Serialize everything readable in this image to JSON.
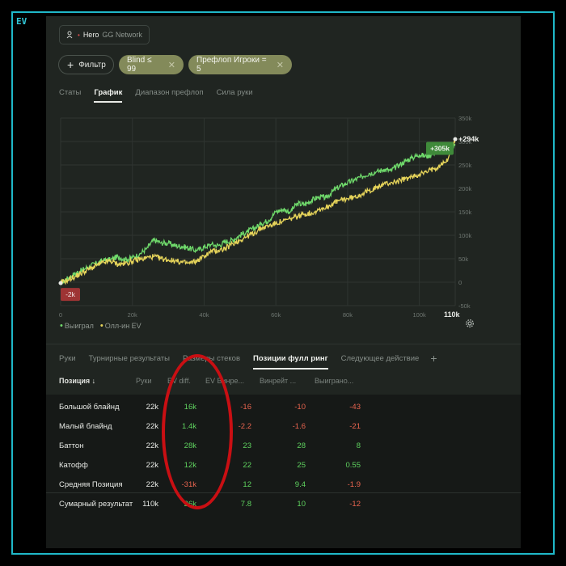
{
  "corner_tag": "EV",
  "player": {
    "name": "Hero",
    "network": "GG Network"
  },
  "filters": {
    "add_label": "Фильтр",
    "active": [
      {
        "label": "Blind ≤ 99"
      },
      {
        "label": "Префлоп Игроки = 5"
      }
    ]
  },
  "tabs": [
    "Статы",
    "График",
    "Диапазон префлоп",
    "Сила руки"
  ],
  "active_tab": "График",
  "chart_data": {
    "type": "line",
    "x": [
      0,
      2,
      4,
      6,
      8,
      10,
      12,
      14,
      16,
      18,
      20,
      22,
      24,
      26,
      28,
      30,
      32,
      34,
      36,
      38,
      40,
      42,
      44,
      46,
      48,
      50,
      52,
      54,
      56,
      58,
      60,
      62,
      64,
      66,
      68,
      70,
      72,
      74,
      76,
      78,
      80,
      82,
      84,
      86,
      88,
      90,
      92,
      94,
      96,
      98,
      100,
      102,
      104,
      106,
      108,
      110
    ],
    "series": [
      {
        "name": "Выиграл",
        "color": "#6fd96b",
        "values": [
          -2,
          8,
          18,
          26,
          34,
          40,
          46,
          48,
          55,
          48,
          52,
          60,
          72,
          90,
          84,
          83,
          78,
          76,
          72,
          67,
          75,
          80,
          78,
          86,
          90,
          100,
          108,
          115,
          125,
          132,
          150,
          155,
          150,
          168,
          165,
          175,
          182,
          180,
          195,
          205,
          212,
          218,
          225,
          232,
          235,
          240,
          238,
          248,
          258,
          265,
          272,
          268,
          275,
          285,
          280,
          294
        ]
      },
      {
        "name": "Олл-ин EV",
        "color": "#e6d45a",
        "values": [
          -2,
          5,
          12,
          20,
          28,
          35,
          42,
          45,
          38,
          40,
          45,
          48,
          52,
          55,
          50,
          48,
          45,
          42,
          40,
          46,
          55,
          65,
          68,
          72,
          82,
          90,
          98,
          105,
          115,
          120,
          126,
          130,
          135,
          140,
          145,
          148,
          155,
          160,
          168,
          175,
          178,
          182,
          188,
          195,
          202,
          208,
          212,
          215,
          220,
          225,
          230,
          235,
          242,
          250,
          262,
          305
        ]
      }
    ],
    "x_ticks": [
      "0",
      "20k",
      "40k",
      "60k",
      "80k",
      "100k"
    ],
    "x_end_label": "110k",
    "y_ticks": [
      "-50k",
      "0",
      "50k",
      "100k",
      "150k",
      "200k",
      "250k",
      "300k",
      "350k"
    ],
    "ylim": [
      -50,
      350
    ],
    "xlim": [
      0,
      110
    ],
    "start_label": "-2k",
    "end_labels": {
      "won": "+294k",
      "ev": "+305k"
    },
    "grid": true
  },
  "legend": [
    "Выиграл",
    "Олл-ин EV"
  ],
  "bottom_tabs": [
    "Руки",
    "Турнирные результаты",
    "Размеры стеков",
    "Позиции фулл ринг",
    "Следующее действие"
  ],
  "bottom_active": "Позиции фулл ринг",
  "table": {
    "headers": [
      "Позиция ↓",
      "Руки",
      "EV diff.",
      "EV Винре...",
      "Винрейт ...",
      "Выиграно..."
    ],
    "rows": [
      {
        "pos": "Большой блайнд",
        "hands": "22k",
        "evdiff": "16k",
        "evwin": "-16",
        "win": "-10",
        "won": "-43"
      },
      {
        "pos": "Малый блайнд",
        "hands": "22k",
        "evdiff": "1.4k",
        "evwin": "-2.2",
        "win": "-1.6",
        "won": "-21"
      },
      {
        "pos": "Баттон",
        "hands": "22k",
        "evdiff": "28k",
        "evwin": "23",
        "win": "28",
        "won": "8"
      },
      {
        "pos": "Катофф",
        "hands": "22k",
        "evdiff": "12k",
        "evwin": "22",
        "win": "25",
        "won": "0.55"
      },
      {
        "pos": "Средняя Позиция",
        "hands": "22k",
        "evdiff": "-31k",
        "evwin": "12",
        "win": "9.4",
        "won": "-1.9"
      },
      {
        "pos": "Сумарный результат",
        "hands": "110k",
        "evdiff": "26k",
        "evwin": "7.8",
        "win": "10",
        "won": "-12"
      }
    ]
  }
}
